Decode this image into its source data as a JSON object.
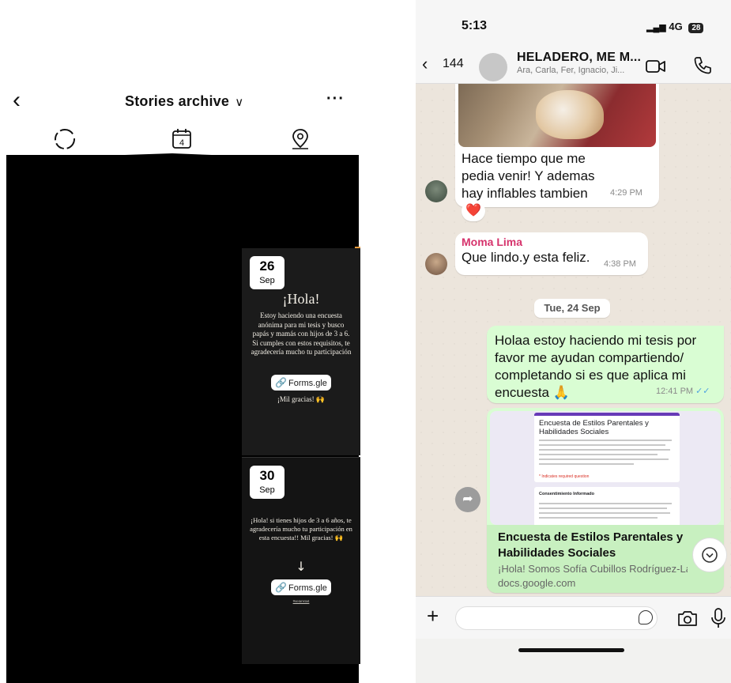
{
  "instagram": {
    "title": "Stories archive",
    "title_chevron": "∨",
    "back_icon": "chevron-left-icon",
    "more_label": "···",
    "tabs": [
      {
        "icon": "stories-circle-icon"
      },
      {
        "icon": "calendar-icon",
        "calendar_number": "4"
      },
      {
        "icon": "location-pin-icon"
      }
    ],
    "stories": [
      {
        "day": "26",
        "month": "Sep",
        "heading": "¡Hola!",
        "body": "Estoy haciendo una encuesta anónima para mi tesis y busco papás y mamás con hijos de 3 a 6. Si cumples con estos requisitos, te agradecería mucho tu participación",
        "link_label": "Forms.gle",
        "closing": "¡Mil gracias! 🙌"
      },
      {
        "day": "30",
        "month": "Sep",
        "body": "¡Hola! si tienes hijos de 3 a 6 años, te agradecería mucho tu participación en esta encuesta!! Mil gracias! 🙌",
        "arrow": "↓",
        "link_label": "Forms.gle",
        "footer": "#solaridad"
      }
    ]
  },
  "whatsapp": {
    "status_bar": {
      "time": "5:13",
      "network": "4G",
      "battery": "28"
    },
    "header": {
      "back_count": "144",
      "group_name": "HELADERO, ME M...",
      "members": "Ara, Carla, Fer, Ignacio, Ji..."
    },
    "messages": [
      {
        "text": "Hace tiempo que me pedia venir! Y ademas hay inflables tambien",
        "time": "4:29 PM",
        "reaction": "❤️"
      },
      {
        "sender": "Moma Lima",
        "text": "Que lindo.y esta feliz.",
        "time": "4:38 PM"
      },
      {
        "day_separator": "Tue, 24 Sep"
      },
      {
        "text": "Holaa estoy haciendo mi tesis por favor me ayudan compartiendo/ completando si es que aplica mi encuesta 🙏",
        "time": "12:41 PM",
        "status": "✓✓"
      },
      {
        "link_preview": {
          "form_title": "Encuesta de Estilos Parentales y Habilidades Sociales",
          "form_required_note": "* Indicates required question",
          "form_section": "Consentimiento Informado",
          "title": "Encuesta de Estilos Parentales y Habilidades Sociales",
          "description": "¡Hola! Somos Sofía Cubillos Rodríguez-Lar",
          "url": "docs.google.com"
        }
      }
    ],
    "scroll_down_icon": "chevron-down-icon",
    "compose": {
      "plus": "+",
      "placeholder": ""
    },
    "colors": {
      "outgoing_bubble": "#d9fdd3",
      "sender_name": "#d6336c",
      "read_ticks": "#4fa3e0"
    }
  }
}
